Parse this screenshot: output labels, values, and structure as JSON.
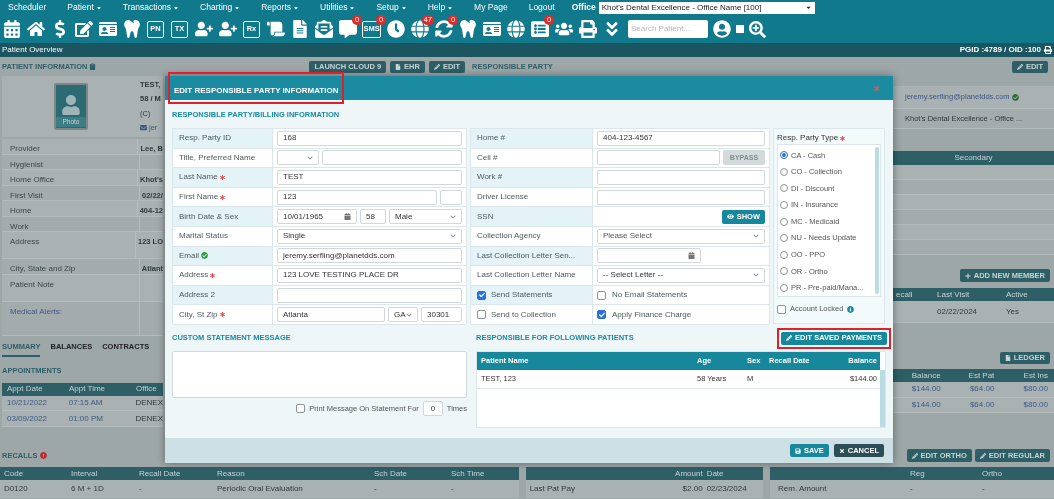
{
  "menu_bar": {
    "items": [
      {
        "label": "Scheduler",
        "dropdown": false
      },
      {
        "label": "Patient",
        "dropdown": true
      },
      {
        "label": "Transactions",
        "dropdown": true
      },
      {
        "label": "Charting",
        "dropdown": true
      },
      {
        "label": "Reports",
        "dropdown": true
      },
      {
        "label": "Utilities",
        "dropdown": true
      },
      {
        "label": "Setup",
        "dropdown": true
      },
      {
        "label": "Help",
        "dropdown": true
      },
      {
        "label": "My Page",
        "dropdown": false
      },
      {
        "label": "Logout",
        "dropdown": false
      }
    ],
    "office_label": "Office",
    "office_value": "Khot's Dental Excellence - Office Name [100]"
  },
  "toolbar": {
    "tools": [
      {
        "kind": "calendar"
      },
      {
        "kind": "home"
      },
      {
        "kind": "dollar"
      },
      {
        "kind": "edit"
      },
      {
        "kind": "idcard"
      },
      {
        "kind": "tooth"
      },
      {
        "kind": "label",
        "label": "PN"
      },
      {
        "kind": "label",
        "label": "TX"
      },
      {
        "kind": "userplus"
      },
      {
        "kind": "userplus"
      },
      {
        "kind": "label",
        "label": "Rx"
      },
      {
        "kind": "scroll"
      },
      {
        "kind": "file"
      },
      {
        "kind": "mail"
      },
      {
        "kind": "chat",
        "badge": "0"
      },
      {
        "kind": "label",
        "label": "SMS",
        "badge": "0"
      },
      {
        "kind": "clock"
      },
      {
        "kind": "globe",
        "badge": "47"
      },
      {
        "kind": "refresh",
        "badge": "0"
      },
      {
        "kind": "tooth"
      },
      {
        "kind": "idcard"
      },
      {
        "kind": "globe"
      },
      {
        "kind": "list",
        "badge": "0"
      },
      {
        "kind": "users"
      },
      {
        "kind": "printer"
      },
      {
        "kind": "chevrons"
      }
    ],
    "search": {
      "placeholder": "Search Patient..."
    }
  },
  "page_header": {
    "title": "Patient Overview",
    "ids": "PGID :4789 / OID :100"
  },
  "patient_info": {
    "title": "PATIENT INFORMATION",
    "photo_label": "Photo",
    "summary_lines": [
      "TEST,",
      "58 / M",
      "(C)"
    ],
    "email_fragment": "jer",
    "fields": [
      {
        "label": "Provider",
        "value": "Lee, B",
        "kind": "plain"
      },
      {
        "label": "Hygienist",
        "kind": "plain"
      },
      {
        "label": "Home Office",
        "value": "Khot's",
        "kind": "plain"
      },
      {
        "label": "First Visit",
        "value": "02/22/",
        "kind": "plain"
      },
      {
        "label": "Home",
        "value": "404-12",
        "kind": "plain"
      },
      {
        "label": "Work",
        "kind": "plain"
      },
      {
        "label": "Address",
        "value": "123 LO",
        "kind": "tall"
      },
      {
        "label": "City, State and Zip",
        "value": "Atlant",
        "kind": "plain"
      },
      {
        "label": "Patient Note",
        "kind": "tall"
      },
      {
        "label": "Medical Alerts:",
        "kind": "alert"
      }
    ]
  },
  "actions": [
    {
      "label": "LAUNCH CLOUD 9",
      "kind": "plain"
    },
    {
      "label": "EHR",
      "kind": "file"
    },
    {
      "label": "EDIT",
      "kind": "edit"
    }
  ],
  "responsible_party": {
    "title": "RESPONSIBLE PARTY",
    "edit": "EDIT",
    "email": "jeremy.serfling@planetdds.com",
    "office": "Khot's Dental Excellence - Office ...",
    "insurance_header": "Secondary",
    "add_member": "ADD NEW MEMBER",
    "family_columns": [
      "ecall",
      "Last Visit",
      "Active"
    ],
    "family_rows": [
      {
        "last_visit": "02/22/2024",
        "active": "Yes"
      }
    ]
  },
  "tabs": [
    {
      "label": "SUMMARY",
      "selected": true
    },
    {
      "label": "BALANCES",
      "selected": false
    },
    {
      "label": "CONTRACTS",
      "selected": false
    }
  ],
  "appointments": {
    "title": "APPOINTMENTS",
    "ledger": "LEDGER",
    "left_columns": [
      "Appt Date",
      "Appt Time",
      "Office"
    ],
    "right_columns": [
      "Balance",
      "Est Pat",
      "Est Ins"
    ],
    "rows": [
      {
        "date": "10/21/2022",
        "time": "07:15 AM",
        "office": "DENEX",
        "balance": "$144.00",
        "est_pat": "$64.00",
        "est_ins": "$80.00"
      },
      {
        "date": "03/09/2022",
        "time": "01:00 PM",
        "office": "DENEX",
        "balance": "$144.00",
        "est_pat": "$64.00",
        "est_ins": "$80.00"
      }
    ]
  },
  "recalls": {
    "title": "RECALLS",
    "edit_ortho": "EDIT ORTHO",
    "edit_regular": "EDIT REGULAR",
    "columns": [
      "Code",
      "Interval",
      "Recall Date",
      "Reason",
      "Sch Date",
      "Sch Time"
    ],
    "rows": [
      [
        "D0120",
        "6 M + 1D",
        "-",
        "Periodic Oral Evaluation",
        "-",
        "-"
      ]
    ]
  },
  "payments": {
    "columns": [
      "Amount",
      "Date"
    ],
    "row": {
      "label": "Last Pat Pay",
      "amount": "$2.00",
      "date": "02/23/2024"
    }
  },
  "remaining": {
    "columns": [
      "Reg",
      "Ortho"
    ],
    "row": [
      "Rem. Amount",
      "-",
      "-"
    ]
  },
  "dialog": {
    "title": "EDIT RESPONSIBLE PARTY INFORMATION",
    "title_highlighted": true,
    "section_title": "RESPONSIBLE PARTY/BILLING INFORMATION",
    "left_fields": [
      {
        "label": "Resp. Party ID",
        "required": false,
        "verified": false,
        "kind": "readonly",
        "value": "168"
      },
      {
        "label": "Title, Preferred Name",
        "required": false,
        "verified": false,
        "kind": "title_name"
      },
      {
        "label": "Last Name",
        "required": true,
        "verified": false,
        "kind": "text",
        "value": "TEST"
      },
      {
        "label": "First Name",
        "required": true,
        "verified": false,
        "kind": "text_mi",
        "value": "123"
      },
      {
        "label": "Birth Date & Sex",
        "required": false,
        "verified": false,
        "kind": "birth",
        "value": "10/01/1965",
        "age": "58",
        "sex": "Male"
      },
      {
        "label": "Marital Status",
        "required": false,
        "verified": false,
        "kind": "select",
        "value": "Single"
      },
      {
        "label": "Email",
        "required": false,
        "verified": true,
        "kind": "text",
        "value": "jeremy.serfling@planetdds.com"
      },
      {
        "label": "Address",
        "required": true,
        "verified": false,
        "kind": "text",
        "value": "123 LOVE TESTING PLACE DR"
      },
      {
        "label": "Address 2",
        "required": false,
        "verified": false,
        "kind": "text"
      },
      {
        "label": "City, St Zip",
        "required": true,
        "verified": false,
        "kind": "city",
        "value": "Atlanta",
        "state": "GA",
        "zip": "30301"
      }
    ],
    "middle_fields": [
      {
        "label": "Home #",
        "kind": "text",
        "value": "404-123-4567"
      },
      {
        "label": "Cell #",
        "kind": "bypass",
        "button": "BYPASS",
        "disabled": true
      },
      {
        "label": "Work #",
        "kind": "text"
      },
      {
        "label": "Driver License",
        "kind": "text"
      },
      {
        "label": "SSN",
        "kind": "show",
        "button": "SHOW"
      },
      {
        "label": "Collection Agency",
        "kind": "select",
        "value": "Please Select",
        "disabled": true
      },
      {
        "label": "Last Collection Letter Sen...",
        "kind": "date"
      },
      {
        "label": "Last Collection Letter Name",
        "kind": "select",
        "value": "-- Select Letter --",
        "disabled": false
      },
      {
        "kind": "checks",
        "checks": [
          {
            "label": "Send Statements",
            "checked": true
          },
          {
            "label": "No Email Statements",
            "checked": false
          }
        ]
      },
      {
        "kind": "checks",
        "checks": [
          {
            "label": "Send to Collection",
            "checked": false
          },
          {
            "label": "Apply Finance Charge",
            "checked": true
          }
        ]
      }
    ],
    "party_type": {
      "label": "Resp. Party Type",
      "required": true,
      "options": [
        {
          "label": "CA - Cash",
          "selected": true
        },
        {
          "label": "CO - Collection",
          "selected": false
        },
        {
          "label": "DI - Discount",
          "selected": false
        },
        {
          "label": "IN - Insurance",
          "selected": false
        },
        {
          "label": "MC - Medicaid",
          "selected": false
        },
        {
          "label": "NU - Needs Update",
          "selected": false
        },
        {
          "label": "OO - PPO",
          "selected": false
        },
        {
          "label": "OR - Ortho",
          "selected": false
        },
        {
          "label": "PR - Pre-paid/Mana...",
          "selected": false
        }
      ]
    },
    "account_locked": {
      "label": "Account Locked",
      "checked": false
    },
    "edit_saved_payments": {
      "label": "EDIT SAVED PAYMENTS",
      "highlighted": true
    },
    "custom_message": {
      "title": "CUSTOM STATEMENT MESSAGE",
      "print_label": "Print Message On Statement For",
      "print_checked": false,
      "times_value": "0",
      "times_label": "Times"
    },
    "patients": {
      "title": "RESPONSIBLE FOR FOLLOWING PATIENTS",
      "columns": [
        "Patient Name",
        "Age",
        "Sex",
        "Recall Date",
        "Balance"
      ],
      "rows": [
        {
          "name": "TEST, 123",
          "age": "58 Years",
          "sex": "M",
          "balance": "$144.00"
        }
      ]
    },
    "save": "SAVE",
    "cancel": "CANCEL"
  }
}
